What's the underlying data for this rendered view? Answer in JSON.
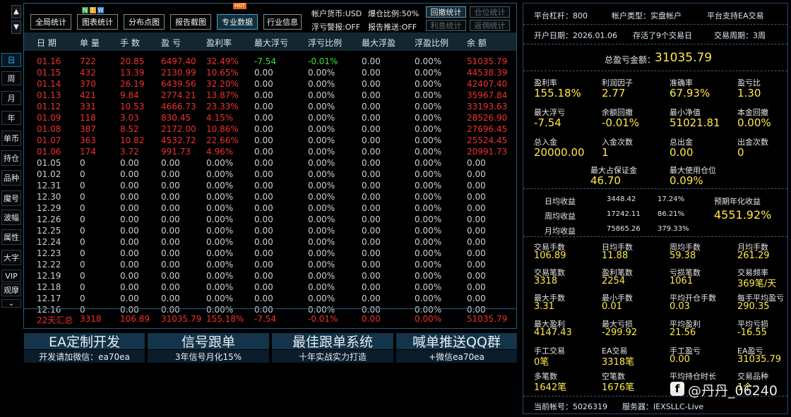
{
  "scroll": {
    "up_icon": "▲",
    "down_icon": "▼"
  },
  "left_nav": [
    "日",
    "周",
    "月",
    "年",
    "单币",
    "持仓",
    "品种",
    "魔号",
    "波幅",
    "属性",
    "大字",
    "VIP",
    "观摩"
  ],
  "left_nav_more_icon": "⌄",
  "toolbar": {
    "buttons": [
      "全局统计",
      "图表统计",
      "分布点图",
      "报告截图",
      "专业数据",
      "行业信息"
    ],
    "new_badge": [
      "N",
      "E",
      "W"
    ],
    "hot_badge": "HOT"
  },
  "account_info": {
    "currency": "帐户货币:USD",
    "margin_ratio": "爆仓比例:50%",
    "float_alert": "浮亏警报:OFF",
    "report_push": "报告推送:OFF"
  },
  "small_buttons": [
    "回撤统计",
    "仓位统计",
    "利息统计",
    "返佣统计"
  ],
  "table": {
    "headers": [
      "日 期",
      "单 量",
      "手 数",
      "盈 亏",
      "盈利率",
      "最大浮亏",
      "浮亏比例",
      "最大浮盈",
      "浮盈比例",
      "余 额"
    ],
    "rows": [
      [
        "01.16",
        "722",
        "20.85",
        "6497.40",
        "32.49%",
        "-7.54",
        "-0.01%",
        "0.00",
        "0.00%",
        "51035.79"
      ],
      [
        "01.15",
        "432",
        "13.39",
        "2130.99",
        "10.65%",
        "0.00",
        "0.00%",
        "0.00",
        "0.00%",
        "44538.39"
      ],
      [
        "01.14",
        "370",
        "26.19",
        "6439.56",
        "32.20%",
        "0.00",
        "0.00%",
        "0.00",
        "0.00%",
        "42407.40"
      ],
      [
        "01.13",
        "421",
        "9.84",
        "2774.21",
        "13.87%",
        "0.00",
        "0.00%",
        "0.00",
        "0.00%",
        "35967.84"
      ],
      [
        "01.12",
        "331",
        "10.53",
        "4666.73",
        "23.33%",
        "0.00",
        "0.00%",
        "0.00",
        "0.00%",
        "33193.63"
      ],
      [
        "01.09",
        "118",
        "3.03",
        "830.45",
        "4.15%",
        "0.00",
        "0.00%",
        "0.00",
        "0.00%",
        "28526.90"
      ],
      [
        "01.08",
        "387",
        "8.52",
        "2172.00",
        "10.86%",
        "0.00",
        "0.00%",
        "0.00",
        "0.00%",
        "27696.45"
      ],
      [
        "01.07",
        "363",
        "10.82",
        "4532.72",
        "22.66%",
        "0.00",
        "0.00%",
        "0.00",
        "0.00%",
        "25524.45"
      ],
      [
        "01.06",
        "174",
        "3.72",
        "991.73",
        "4.96%",
        "0.00",
        "0.00%",
        "0.00",
        "0.00%",
        "20991.73"
      ],
      [
        "01.05",
        "0",
        "0.00",
        "0.00",
        "0.00%",
        "0.00",
        "0.00%",
        "0.00",
        "0.00%",
        "0.00"
      ],
      [
        "01.02",
        "0",
        "0.00",
        "0.00",
        "0.00%",
        "0.00",
        "0.00%",
        "0.00",
        "0.00%",
        "0.00"
      ],
      [
        "12.31",
        "0",
        "0.00",
        "0.00",
        "0.00%",
        "0.00",
        "0.00%",
        "0.00",
        "0.00%",
        "0.00"
      ],
      [
        "12.30",
        "0",
        "0.00",
        "0.00",
        "0.00%",
        "0.00",
        "0.00%",
        "0.00",
        "0.00%",
        "0.00"
      ],
      [
        "12.29",
        "0",
        "0.00",
        "0.00",
        "0.00%",
        "0.00",
        "0.00%",
        "0.00",
        "0.00%",
        "0.00"
      ],
      [
        "12.26",
        "0",
        "0.00",
        "0.00",
        "0.00%",
        "0.00",
        "0.00%",
        "0.00",
        "0.00%",
        "0.00"
      ],
      [
        "12.25",
        "0",
        "0.00",
        "0.00",
        "0.00%",
        "0.00",
        "0.00%",
        "0.00",
        "0.00%",
        "0.00"
      ],
      [
        "12.24",
        "0",
        "0.00",
        "0.00",
        "0.00%",
        "0.00",
        "0.00%",
        "0.00",
        "0.00%",
        "0.00"
      ],
      [
        "12.23",
        "0",
        "0.00",
        "0.00",
        "0.00%",
        "0.00",
        "0.00%",
        "0.00",
        "0.00%",
        "0.00"
      ],
      [
        "12.22",
        "0",
        "0.00",
        "0.00",
        "0.00%",
        "0.00",
        "0.00%",
        "0.00",
        "0.00%",
        "0.00"
      ],
      [
        "12.19",
        "0",
        "0.00",
        "0.00",
        "0.00%",
        "0.00",
        "0.00%",
        "0.00",
        "0.00%",
        "0.00"
      ],
      [
        "12.18",
        "0",
        "0.00",
        "0.00",
        "0.00%",
        "0.00",
        "0.00%",
        "0.00",
        "0.00%",
        "0.00"
      ],
      [
        "12.17",
        "0",
        "0.00",
        "0.00",
        "0.00%",
        "0.00",
        "0.00%",
        "0.00",
        "0.00%",
        "0.00"
      ],
      [
        "12.16",
        "0",
        "0.00",
        "0.00",
        "0.00%",
        "0.00",
        "0.00%",
        "0.00",
        "0.00%",
        "0.00"
      ]
    ],
    "summary": [
      "22天汇总",
      "3318",
      "106.89",
      "31035.79",
      "155.18%",
      "-7.54",
      "-0.01%",
      "0.00",
      "0.00%",
      "51035.79"
    ]
  },
  "promos": [
    {
      "title": "EA定制开发",
      "subtitle": "开发请加微信：ea70ea"
    },
    {
      "title": "信号跟单",
      "subtitle": "3年信号月化15%"
    },
    {
      "title": "最佳跟单系统",
      "subtitle": "十年实战实力打造"
    },
    {
      "title": "喊单推送QQ群",
      "subtitle": "+微信ea70ea"
    }
  ],
  "right": {
    "platform_leverage": "平台杠杆：800",
    "account_type": "帐户类型：实盘帐户",
    "ea_support": "平台支持EA交易",
    "open_date": "开户日期：2026.01.06",
    "alive_days": "存活了9个交易日",
    "trade_period": "交易周期：3周",
    "total_pnl_label": "总盈亏金额：",
    "total_pnl_value": "31035.79",
    "stats1": [
      [
        [
          "盈利率",
          "155.18%"
        ],
        [
          "利润因子",
          "2.77"
        ],
        [
          "准确率",
          "67.93%"
        ],
        [
          "盈亏比",
          "1.30"
        ]
      ],
      [
        [
          "最大浮亏",
          "-7.54"
        ],
        [
          "余额回撤",
          "-0.01%"
        ],
        [
          "最小净值",
          "51021.81"
        ],
        [
          "本金回撤",
          "0.00%"
        ]
      ],
      [
        [
          "总入金",
          "20000.00"
        ],
        [
          "入金次数",
          "1"
        ],
        [
          "总出金",
          "0.00"
        ],
        [
          "出金次数",
          "0"
        ]
      ]
    ],
    "max_margin_label": "最大占保证金",
    "max_margin_value": "46.70",
    "max_position_label": "最大使用仓位",
    "max_position_value": "0.09%",
    "returns": [
      [
        "日均收益",
        "3448.42",
        "17.24%"
      ],
      [
        "周均收益",
        "17242.11",
        "86.21%"
      ],
      [
        "月均收益",
        "75865.26",
        "379.33%"
      ]
    ],
    "annual_label": "预期年化收益",
    "annual_value": "4551.92%",
    "stats2": [
      [
        [
          "交易手数",
          "106.89"
        ],
        [
          "日均手数",
          "11.88"
        ],
        [
          "周均手数",
          "59.38"
        ],
        [
          "月均手数",
          "261.29"
        ]
      ],
      [
        [
          "交易笔数",
          "3318"
        ],
        [
          "盈利笔数",
          "2254"
        ],
        [
          "亏损笔数",
          "1061"
        ],
        [
          "交易频率",
          "369笔/天"
        ]
      ],
      [
        [
          "最大手数",
          "3.31"
        ],
        [
          "最小手数",
          "0.01"
        ],
        [
          "平均开仓手数",
          "0.03"
        ],
        [
          "每手平均盈亏",
          "290.35"
        ]
      ],
      [
        [
          "最大盈利",
          "4147.43"
        ],
        [
          "最大亏损",
          "-299.92"
        ],
        [
          "平均盈利",
          "21.56"
        ],
        [
          "平均亏损",
          "-16.55"
        ]
      ],
      [
        [
          "手工交易",
          "0笔"
        ],
        [
          "EA交易",
          "3318笔"
        ],
        [
          "手工盈亏",
          "0.00"
        ],
        [
          "EA盈亏",
          "31035.79"
        ]
      ],
      [
        [
          "多笔数",
          "1642笔"
        ],
        [
          "空笔数",
          "1676笔"
        ],
        [
          "平均持仓时长",
          "0时"
        ],
        [
          "交易品种",
          "1个"
        ]
      ]
    ],
    "account_no": "当前帐号：5026319",
    "server": "服务器：IEXSLLC-Live",
    "watermark": "@丹丹_06240"
  },
  "colors": {
    "accent": "#2fb7ff",
    "loss": "#f03030",
    "gain": "#34e234",
    "highlight": "#ffe94a",
    "header_bg": "#142632"
  }
}
